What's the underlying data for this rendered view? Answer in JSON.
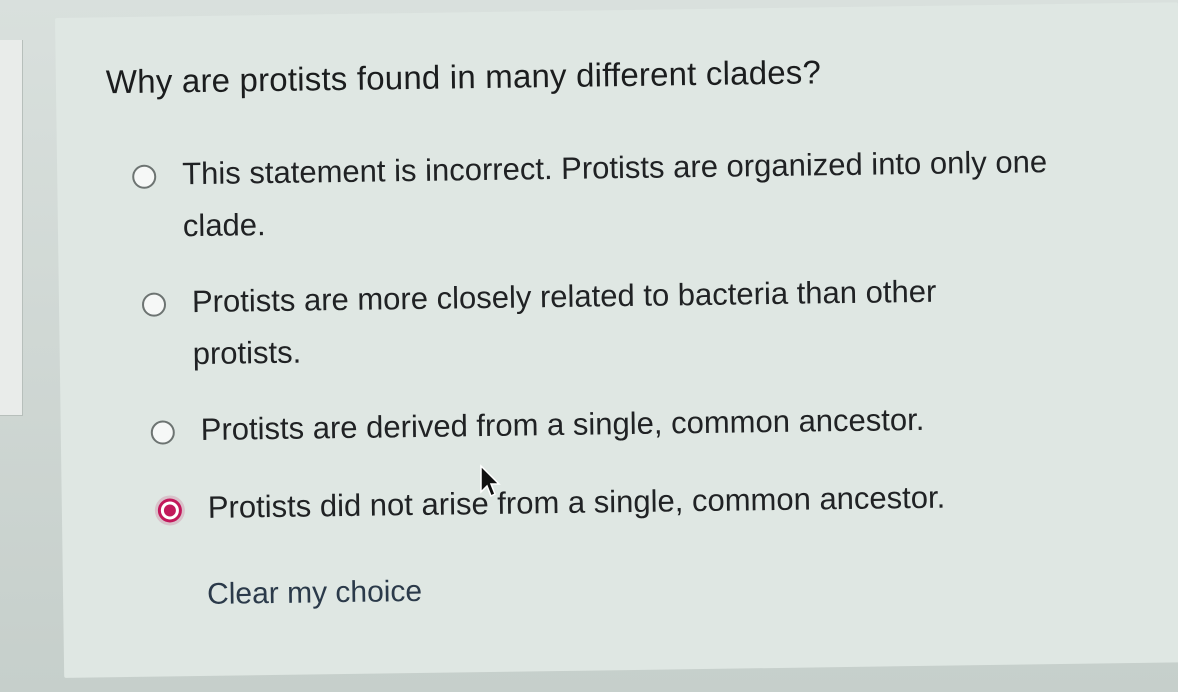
{
  "question": {
    "text": "Why are protists found in many different clades?"
  },
  "options": [
    {
      "label": "This statement is incorrect.  Protists are organized into only one clade.",
      "selected": false
    },
    {
      "label": "Protists are more closely related to bacteria than other protists.",
      "selected": false
    },
    {
      "label": "Protists are derived from a single, common ancestor.",
      "selected": false
    },
    {
      "label": "Protists did not arise from a single, common ancestor.",
      "selected": true
    }
  ],
  "clear_choice": {
    "label": "Clear my choice"
  },
  "colors": {
    "selected_radio": "#c2185b",
    "card_background": "#dfe7e3",
    "link": "#2b3a4a"
  },
  "icons": {
    "cursor": "mouse-pointer-icon"
  }
}
